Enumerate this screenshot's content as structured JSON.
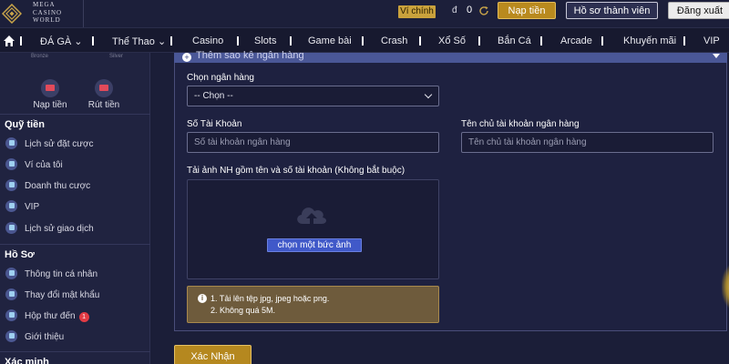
{
  "header": {
    "logo_lines": [
      "MEGA",
      "CASINO",
      "WORLD"
    ],
    "wallet_label": "Ví chính",
    "wallet_currency": "đ",
    "wallet_balance": "0",
    "deposit_button": "Nạp tiền",
    "profile_button": "Hồ sơ thành viên",
    "logout_button": "Đăng xuất"
  },
  "nav": {
    "items": [
      "ĐÁ GÀ",
      "Thể Thao",
      "Casino",
      "Slots",
      "Game bài",
      "Crash",
      "Xổ Số",
      "Bắn Cá",
      "Arcade",
      "Khuyến mãi",
      "VIP"
    ]
  },
  "sidebar": {
    "faded_labels": [
      "Bronze",
      "Silver"
    ],
    "actions": [
      "Nạp tiền",
      "Rút tiền"
    ],
    "sections": [
      {
        "title": "Quỹ tiền",
        "items": [
          "Lịch sử đặt cược",
          "Ví của tôi",
          "Doanh thu cược",
          "VIP",
          "Lịch sử giao dịch"
        ]
      },
      {
        "title": "Hồ Sơ",
        "items": [
          "Thông tin cá nhân",
          "Thay đổi mật khẩu",
          "Hộp thư đến",
          "Giới thiệu"
        ]
      },
      {
        "title": "Xác minh",
        "items": []
      }
    ],
    "inbox_badge": "1"
  },
  "form": {
    "collapse_title": "Thêm sao kê ngân hàng",
    "bank_label": "Chọn ngân hàng",
    "bank_value": "-- Chọn --",
    "account_number_label": "Số Tài Khoản",
    "account_number_placeholder": "Số tài khoản ngân hàng",
    "account_holder_label": "Tên chủ tài khoản ngân hàng",
    "account_holder_placeholder": "Tên chủ tài khoản ngân hàng",
    "upload_label": "Tải ảnh NH gồm tên và số tài khoản (Không bắt buộc)",
    "upload_button": "chọn một bức ảnh",
    "info_lines": [
      "1. Tải lên tệp jpg, jpeg hoặc png.",
      "2. Không quá 5M."
    ],
    "confirm_button": "Xác Nhận"
  },
  "colors": {
    "accent_gold": "#b98a1e",
    "upload_blue": "#4059c9",
    "badge_red": "#e23a44"
  }
}
